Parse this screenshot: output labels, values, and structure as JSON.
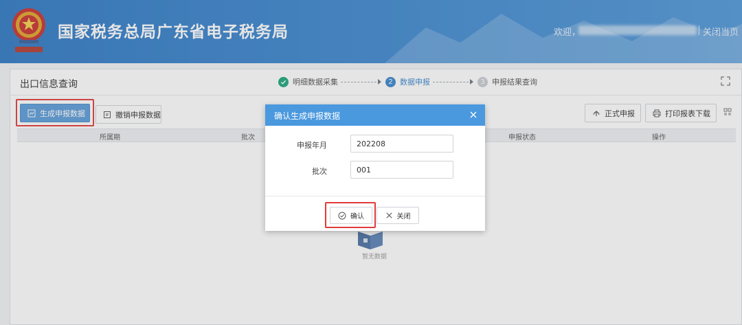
{
  "header": {
    "title": "国家税务总局广东省电子税务局",
    "welcome": "欢迎，",
    "close_page": "关闭当页"
  },
  "panel": {
    "title": "出口信息查询",
    "steps": [
      {
        "number": "1",
        "label": "明细数据采集",
        "state": "done"
      },
      {
        "number": "2",
        "label": "数据申报",
        "state": "active"
      },
      {
        "number": "3",
        "label": "申报结果查询",
        "state": "todo"
      }
    ]
  },
  "toolbar": {
    "generate_label": "生成申报数据",
    "revoke_label": "撤销申报数据",
    "formal_label": "正式申报",
    "print_label": "打印报表下载"
  },
  "table": {
    "columns": [
      "所属期",
      "批次",
      "申报状态",
      "操作"
    ],
    "empty_text": "暂无数据"
  },
  "dialog": {
    "title": "确认生成申报数据",
    "period_label": "申报年月",
    "period_value": "202208",
    "batch_label": "批次",
    "batch_value": "001",
    "confirm_label": "确认",
    "close_label": "关闭"
  },
  "colors": {
    "header_blue": "#3b86cf",
    "dialog_head": "#4a98de",
    "primary_button": "#5b9bd8",
    "highlight_red": "#e23a3a",
    "step_done": "#1aa67a"
  }
}
